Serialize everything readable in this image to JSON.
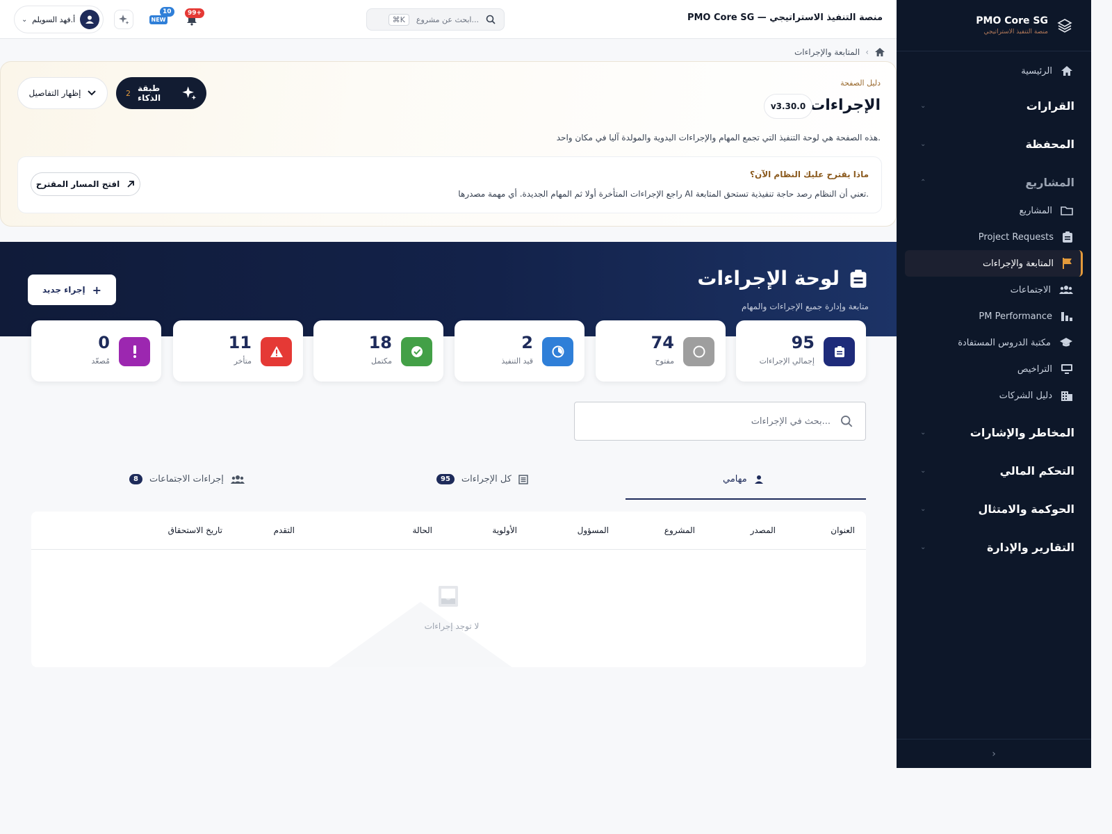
{
  "colors": {
    "sidebar_bg": "#0d1729",
    "accent": "#e39a3b",
    "brand_navy": "#1e2b5a",
    "hero_bg": "#13224a"
  },
  "sidebar": {
    "brand_title": "PMO Core SG",
    "brand_subtitle": "منصة التنفيذ الاستراتيجي",
    "home": "الرئيسية",
    "sections": {
      "decisions": "القرارات",
      "portfolio": "المحفظة",
      "projects": "المشاريع",
      "risks": "المخاطر والإشارات",
      "finance": "التحكم المالي",
      "governance": "الحوكمة والامتثال",
      "reports": "التقارير والإدارة"
    },
    "items": [
      {
        "label": "المشاريع",
        "icon": "folder-icon"
      },
      {
        "label": "Project Requests",
        "icon": "clipboard-icon"
      },
      {
        "label": "المتابعة والإجراءات",
        "icon": "flag-icon",
        "active": true
      },
      {
        "label": "الاجتماعات",
        "icon": "people-icon"
      },
      {
        "label": "PM Performance",
        "icon": "bar-chart-icon"
      },
      {
        "label": "مكتبة الدروس المستفادة",
        "icon": "graduation-cap-icon"
      },
      {
        "label": "التراخيص",
        "icon": "monitor-icon"
      },
      {
        "label": "دليل الشركات",
        "icon": "building-icon"
      }
    ],
    "collapse": "›"
  },
  "topbar": {
    "title": "PMO Core SG — منصة التنفيذ الاستراتيجي",
    "search_placeholder": "ابحث عن مشروع...",
    "search_shortcut": "⌘K",
    "user_name": "أ.فهد السويلم",
    "notif_badge": "99+",
    "news_badge": "10",
    "news_label": "NEW"
  },
  "breadcrumb": {
    "current": "المتابعة والإجراءات"
  },
  "guide": {
    "eyebrow": "دليل الصفحة",
    "title": "الإجراءات",
    "version": "v3.30.0",
    "description": "هذه الصفحة هي لوحة التنفيذ التي تجمع المهام والإجراءات اليدوية والمولدة آليا في مكان واحد.",
    "ai_layer_label": "طبقة الذكاء",
    "ai_layer_count": "2",
    "details_label": "إظهار التفاصيل",
    "suggest_question": "ماذا يقترح عليك النظام الآن؟",
    "suggest_answer": "راجع الإجراءات المتأخرة أولا ثم المهام الجديدة. أي مهمة مصدرها AI تعني أن النظام رصد حاجة تنفيذية تستحق المتابعة.",
    "path_button": "افتح المسار المقترح"
  },
  "hero": {
    "title": "لوحة الإجراءات",
    "subtitle": "متابعة وإدارة جميع الإجراءات والمهام",
    "new_action": "إجراء جديد"
  },
  "stats": [
    {
      "value": "95",
      "label": "إجمالي الإجراءات",
      "color": "#1e2b7a"
    },
    {
      "value": "74",
      "label": "مفتوح",
      "color": "#9e9e9e"
    },
    {
      "value": "2",
      "label": "قيد التنفيذ",
      "color": "#2f7fd8"
    },
    {
      "value": "18",
      "label": "مكتمل",
      "color": "#43a047"
    },
    {
      "value": "11",
      "label": "متأخر",
      "color": "#e53935"
    },
    {
      "value": "0",
      "label": "مُصعّد",
      "color": "#9c27b0"
    }
  ],
  "list_search": {
    "placeholder": "بحث في الإجراءات..."
  },
  "tabs": [
    {
      "label": "مهامي"
    },
    {
      "label": "كل الإجراءات",
      "count": "95"
    },
    {
      "label": "إجراءات الاجتماعات",
      "count": "8"
    }
  ],
  "table": {
    "columns": [
      "العنوان",
      "المصدر",
      "المشروع",
      "المسؤول",
      "الأولوية",
      "الحالة",
      "التقدم",
      "تاريخ الاستحقاق"
    ],
    "empty_text": "لا توجد إجراءات"
  }
}
